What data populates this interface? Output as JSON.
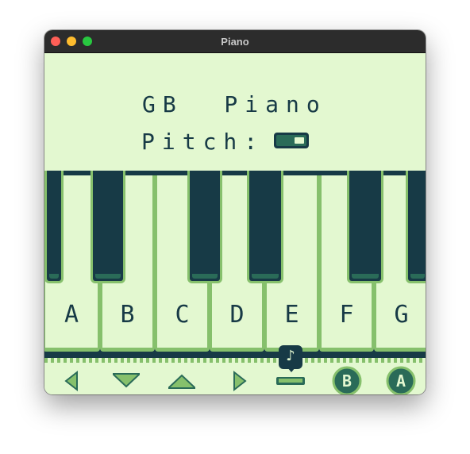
{
  "window": {
    "title": "Piano"
  },
  "app": {
    "heading": "GB  Piano",
    "pitch_label": "Pitch:",
    "pitch_state": "high"
  },
  "keys": {
    "white": [
      "A",
      "B",
      "C",
      "D",
      "E",
      "F",
      "G"
    ]
  },
  "indicator": {
    "glyph": "♪"
  },
  "controls": {
    "b_label": "B",
    "a_label": "A"
  },
  "colors": {
    "darkest": "#173a46",
    "dark": "#2a6b58",
    "light": "#86c06c",
    "lightest": "#e3f8d0"
  }
}
